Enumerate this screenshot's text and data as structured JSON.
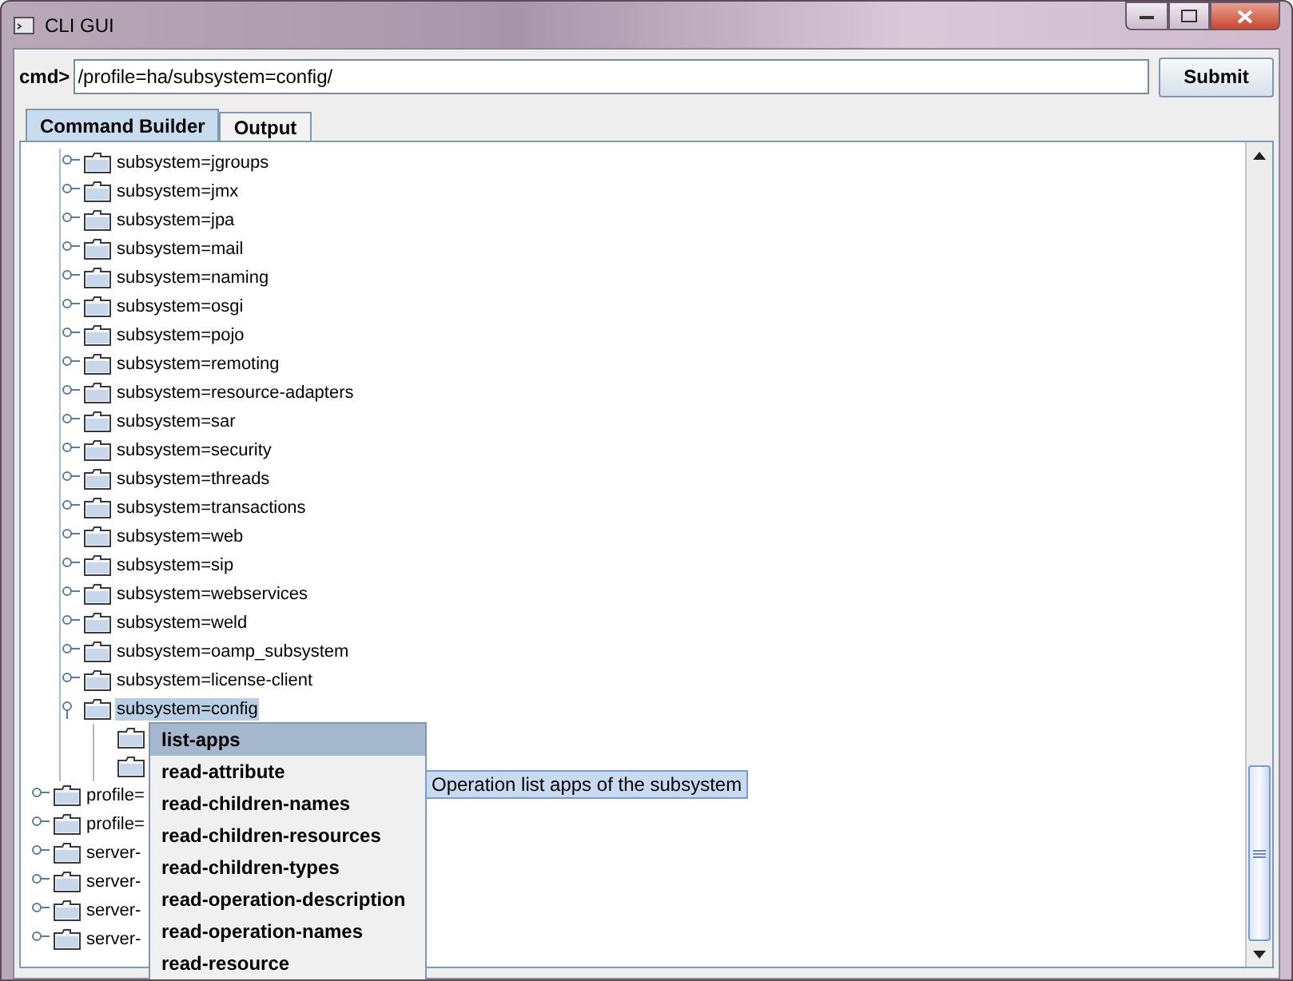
{
  "window": {
    "title": "CLI GUI"
  },
  "command": {
    "label": "cmd>",
    "value": "/profile=ha/subsystem=config/",
    "button": "Submit"
  },
  "tabs": [
    {
      "label": "Command Builder",
      "selected": true
    },
    {
      "label": "Output",
      "selected": false
    }
  ],
  "tree": {
    "items": [
      {
        "children": [
          {
            "label": "subsystem=jgroups",
            "expanded": false,
            "selected": false
          },
          {
            "label": "subsystem=jmx",
            "expanded": false,
            "selected": false
          },
          {
            "label": "subsystem=jpa",
            "expanded": false,
            "selected": false
          },
          {
            "label": "subsystem=mail",
            "expanded": false,
            "selected": false
          },
          {
            "label": "subsystem=naming",
            "expanded": false,
            "selected": false
          },
          {
            "label": "subsystem=osgi",
            "expanded": false,
            "selected": false
          },
          {
            "label": "subsystem=pojo",
            "expanded": false,
            "selected": false
          },
          {
            "label": "subsystem=remoting",
            "expanded": false,
            "selected": false
          },
          {
            "label": "subsystem=resource-adapters",
            "expanded": false,
            "selected": false
          },
          {
            "label": "subsystem=sar",
            "expanded": false,
            "selected": false
          },
          {
            "label": "subsystem=security",
            "expanded": false,
            "selected": false
          },
          {
            "label": "subsystem=threads",
            "expanded": false,
            "selected": false
          },
          {
            "label": "subsystem=transactions",
            "expanded": false,
            "selected": false
          },
          {
            "label": "subsystem=web",
            "expanded": false,
            "selected": false
          },
          {
            "label": "subsystem=sip",
            "expanded": false,
            "selected": false
          },
          {
            "label": "subsystem=webservices",
            "expanded": false,
            "selected": false
          },
          {
            "label": "subsystem=weld",
            "expanded": false,
            "selected": false
          },
          {
            "label": "subsystem=oamp_subsystem",
            "expanded": false,
            "selected": false
          },
          {
            "label": "subsystem=license-client",
            "expanded": false,
            "selected": false
          },
          {
            "label": "subsystem=config",
            "expanded": true,
            "selected": true,
            "children": [
              {
                "kind": "folder"
              },
              {
                "kind": "folder"
              }
            ]
          }
        ]
      },
      {
        "label": "profile=",
        "expanded": false,
        "selected": false
      },
      {
        "label": "profile=",
        "expanded": false,
        "selected": false
      },
      {
        "label": "server-",
        "expanded": false,
        "selected": false
      },
      {
        "label": "server-",
        "expanded": false,
        "selected": false
      },
      {
        "label": "server-",
        "expanded": false,
        "selected": false
      },
      {
        "label": "server-",
        "expanded": false,
        "selected": false
      }
    ]
  },
  "popup_menu": [
    {
      "label": "list-apps",
      "selected": true
    },
    {
      "label": "read-attribute",
      "selected": false
    },
    {
      "label": "read-children-names",
      "selected": false
    },
    {
      "label": "read-children-resources",
      "selected": false
    },
    {
      "label": "read-children-types",
      "selected": false
    },
    {
      "label": "read-operation-description",
      "selected": false
    },
    {
      "label": "read-operation-names",
      "selected": false
    },
    {
      "label": "read-resource",
      "selected": false
    }
  ],
  "tooltip": "Operation list apps of the subsystem"
}
